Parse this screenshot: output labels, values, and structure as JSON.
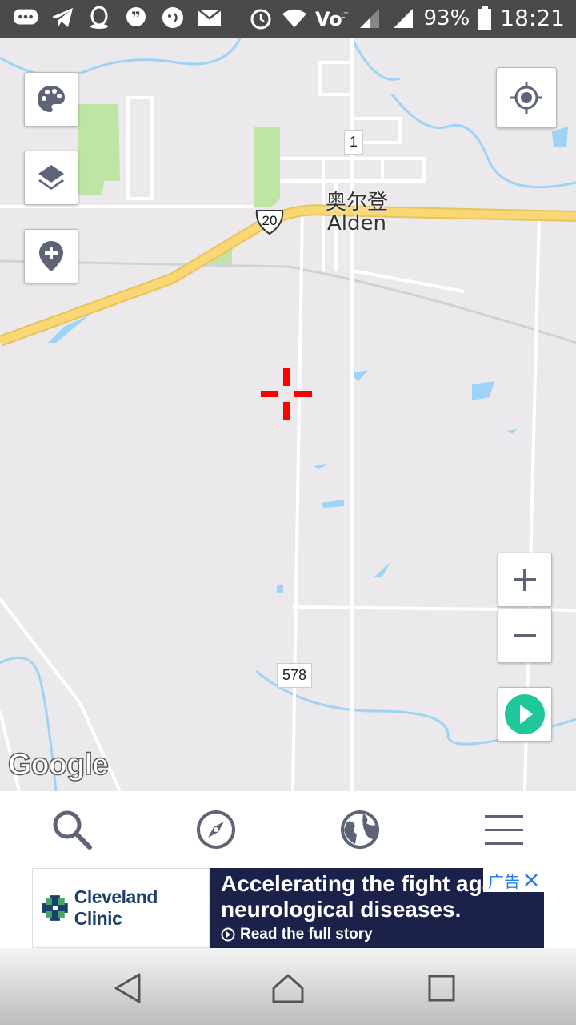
{
  "status_bar": {
    "battery_percent": "93%",
    "time": "18:21",
    "icons": [
      "chat-bubble-icon",
      "telegram-icon",
      "qq-icon",
      "quote-bubble-icon",
      "messenger-icon",
      "mail-icon",
      "alarm-icon",
      "wifi-icon",
      "volte-icon",
      "signal-icon",
      "signal-icon",
      "battery-icon"
    ]
  },
  "map": {
    "town_name_zh": "奥尔登",
    "town_name_en": "Alden",
    "highway_shield": "20",
    "road_label_1": "1",
    "road_label_578": "578",
    "attribution": "Google",
    "colors": {
      "land": "#ece9ec",
      "highway": "#f8d774",
      "water": "#9dd3f5",
      "park": "#bfe5a6",
      "crosshair": "#ff0000"
    }
  },
  "map_controls": {
    "left": [
      "palette-icon",
      "layers-icon",
      "add-pin-icon"
    ],
    "right": [
      "my-location-icon",
      "zoom-in-icon",
      "zoom-out-icon",
      "play-icon"
    ]
  },
  "bottom_nav": {
    "items": [
      "search-icon",
      "compass-icon",
      "globe-icon",
      "menu-icon"
    ]
  },
  "ad": {
    "brand": "Cleveland Clinic",
    "headline": "Accelerating the fight aga\nneurological diseases.",
    "cta": "Read the full story",
    "tag": "广告"
  },
  "system_nav": {
    "buttons": [
      "back-icon",
      "home-icon",
      "recents-icon"
    ]
  }
}
